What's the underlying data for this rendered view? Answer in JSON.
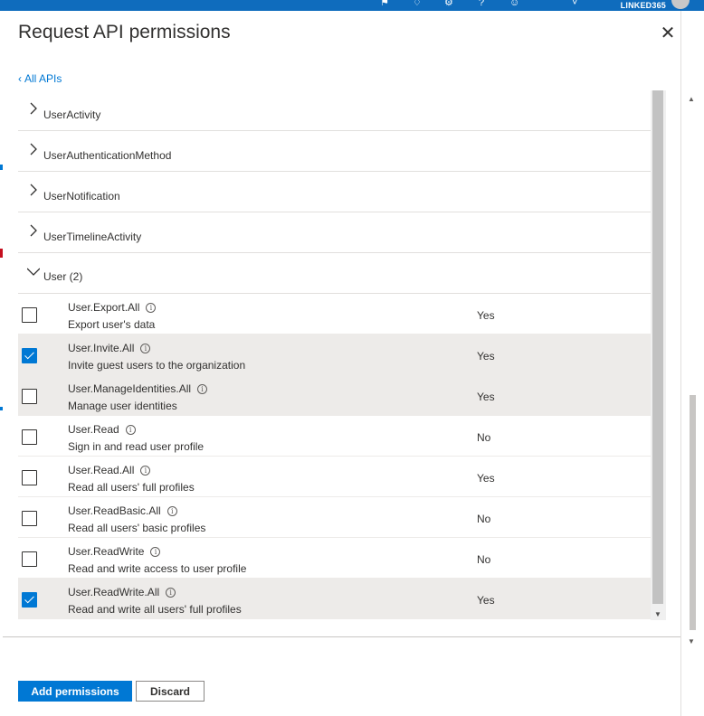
{
  "portal": {
    "tenant_label": "LINKED365",
    "icons": [
      "feedback-icon",
      "bell-icon",
      "gear-icon",
      "help-icon",
      "smiley-icon"
    ]
  },
  "panel": {
    "title": "Request API permissions",
    "back_link": "All APIs",
    "close_icon": "close-icon"
  },
  "groups": [
    {
      "label": "UserActivity",
      "expanded": false
    },
    {
      "label": "UserAuthenticationMethod",
      "expanded": false
    },
    {
      "label": "UserNotification",
      "expanded": false
    },
    {
      "label": "UserTimelineActivity",
      "expanded": false
    },
    {
      "label": "User (2)",
      "expanded": true
    }
  ],
  "permissions": [
    {
      "name": "User.Export.All",
      "description": "Export user's data",
      "admin_consent": "Yes",
      "checked": false
    },
    {
      "name": "User.Invite.All",
      "description": "Invite guest users to the organization",
      "admin_consent": "Yes",
      "checked": true
    },
    {
      "name": "User.ManageIdentities.All",
      "description": "Manage user identities",
      "admin_consent": "Yes",
      "checked": false
    },
    {
      "name": "User.Read",
      "description": "Sign in and read user profile",
      "admin_consent": "No",
      "checked": false
    },
    {
      "name": "User.Read.All",
      "description": "Read all users' full profiles",
      "admin_consent": "Yes",
      "checked": false
    },
    {
      "name": "User.ReadBasic.All",
      "description": "Read all users' basic profiles",
      "admin_consent": "No",
      "checked": false
    },
    {
      "name": "User.ReadWrite",
      "description": "Read and write access to user profile",
      "admin_consent": "No",
      "checked": false
    },
    {
      "name": "User.ReadWrite.All",
      "description": "Read and write all users' full profiles",
      "admin_consent": "Yes",
      "checked": true
    }
  ],
  "footer": {
    "add_label": "Add permissions",
    "discard_label": "Discard"
  },
  "colors": {
    "accent": "#0078d4",
    "selected_row": "#edebe9",
    "portal_bar": "#0f6cbd"
  }
}
